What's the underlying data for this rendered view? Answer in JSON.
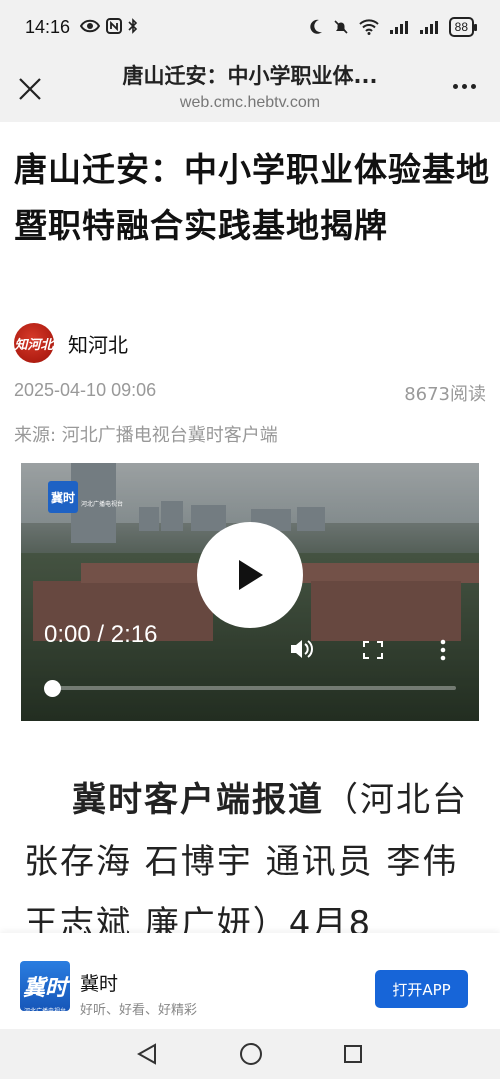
{
  "status_bar": {
    "time": "14:16",
    "battery": "88"
  },
  "browser": {
    "title": "唐山迁安：中小学职业体...",
    "url": "web.cmc.hebtv.com"
  },
  "article": {
    "title": "唐山迁安：中小学职业体验基地暨职特融合实践基地揭牌",
    "author": "知河北",
    "avatar_text": "知河北",
    "date": "2025-04-10 09:06",
    "reads": "8673阅读",
    "source": "来源: 河北广播电视台冀时客户端"
  },
  "video": {
    "logo_text": "冀时",
    "logo_sub": "河北广播电视台",
    "time": "0:00 / 2:16",
    "progress_fraction": 0.0
  },
  "body": {
    "lead": "冀时客户端报道",
    "text": "（河北台 张存海 石博宇 通讯员 李伟 王志斌 廉广妍）4月8"
  },
  "banner": {
    "app_logo_text": "冀时",
    "app_logo_sub": "河北广播电视台",
    "app_name": "冀时",
    "slogan": "好听、好看、好精彩",
    "open_label": "打开APP",
    "accent": "#1765d8"
  }
}
